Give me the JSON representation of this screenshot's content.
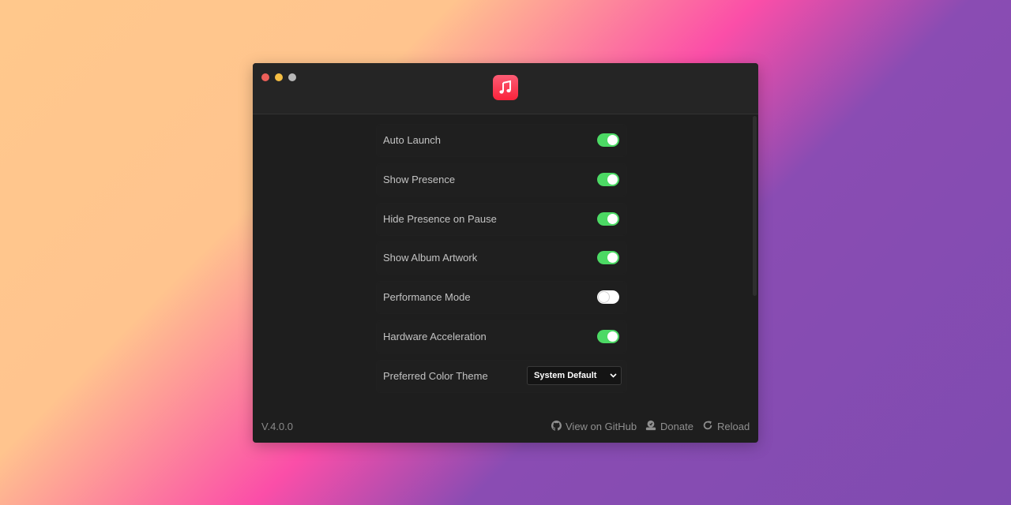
{
  "window": {
    "traffic_lights": {
      "close_color": "#ed5f59",
      "minimize_color": "#f5be43",
      "maximize_color": "#b8b8b8"
    },
    "app_icon": "music-note-icon",
    "accent_color": "#fa233b"
  },
  "settings": [
    {
      "label": "Auto Launch",
      "type": "toggle",
      "on": true
    },
    {
      "label": "Show Presence",
      "type": "toggle",
      "on": true
    },
    {
      "label": "Hide Presence on Pause",
      "type": "toggle",
      "on": true
    },
    {
      "label": "Show Album Artwork",
      "type": "toggle",
      "on": true
    },
    {
      "label": "Performance Mode",
      "type": "toggle",
      "on": false
    },
    {
      "label": "Hardware Acceleration",
      "type": "toggle",
      "on": true
    },
    {
      "label": "Preferred Color Theme",
      "type": "select",
      "value": "System Default"
    }
  ],
  "colors": {
    "toggle_on": "#4cd964",
    "toggle_off": "#ffffff"
  },
  "footer": {
    "version": "V.4.0.0",
    "github_label": "View on GitHub",
    "github_icon": "github-icon",
    "donate_label": "Donate",
    "donate_icon": "donate-icon",
    "reload_label": "Reload",
    "reload_icon": "reload-icon"
  }
}
